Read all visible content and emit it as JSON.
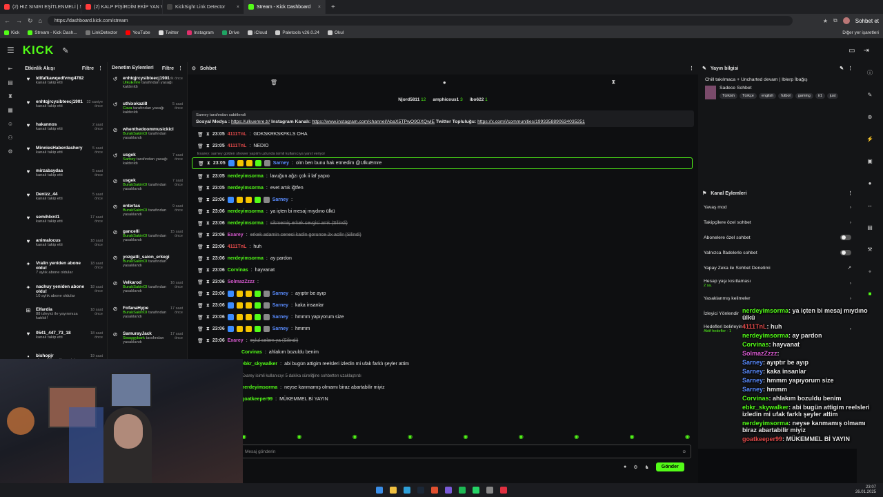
{
  "browser": {
    "tabs": [
      {
        "label": "(2) HIZ SINIRI EŞİTLENMELİ | 5Sni",
        "color": "#ff3b3b"
      },
      {
        "label": "(2) KALP PİŞİRDİM EKİP YAN YATT",
        "color": "#ff3b3b"
      },
      {
        "label": "KickSight Link Detector",
        "color": "#444"
      },
      {
        "label": "Stream - Kick Dashboard",
        "color": "#53fc18"
      }
    ],
    "url": "https://dashboard.kick.com/stream",
    "profile_label": "Sohbet et",
    "bookmarks": [
      {
        "label": "Kick",
        "color": "#53fc18"
      },
      {
        "label": "Stream - Kick Dash...",
        "color": "#53fc18"
      },
      {
        "label": "LinkDetector",
        "color": "#777"
      },
      {
        "label": "YouTube",
        "color": "#ff0000"
      },
      {
        "label": "Twitter",
        "color": "#ddd"
      },
      {
        "label": "Instagram",
        "color": "#e1306c"
      },
      {
        "label": "Drive",
        "color": "#1fa463"
      },
      {
        "label": "iCloud",
        "color": "#ccc"
      },
      {
        "label": "Paletools v26.0.24",
        "color": "#ccc"
      },
      {
        "label": "Okul",
        "color": "#ccc"
      }
    ],
    "other_bookmarks": "Diğer yer işaretleri"
  },
  "kick": {
    "logo": "KICK"
  },
  "activity": {
    "title": "Etkinlik Akışı",
    "filter": "Filtre",
    "items": [
      {
        "name": "ldlfafkawqedfvmg4782",
        "sub": "kanalı takip etti",
        "time": "",
        "icon": "♥"
      },
      {
        "name": "enhtqjrcysibteecj1901",
        "sub": "kanalı takip etti",
        "time": "32 saniye önce",
        "icon": "♥"
      },
      {
        "name": "hakannos",
        "sub": "kanalı takip etti",
        "time": "2 saat önce",
        "icon": "♥"
      },
      {
        "name": "MinniesHaberdashery",
        "sub": "kanalı takip etti",
        "time": "5 saat önce",
        "icon": "♥"
      },
      {
        "name": "mirzabaydas",
        "sub": "kanalı takip etti",
        "time": "5 saat önce",
        "icon": "♥"
      },
      {
        "name": "Denizz_44",
        "sub": "kanalı takip etti",
        "time": "5 saat önce",
        "icon": "♥"
      },
      {
        "name": "semihlxrd1",
        "sub": "kanalı takip etti",
        "time": "17 saat önce",
        "icon": "♥"
      },
      {
        "name": "animalocus",
        "sub": "kanalı takip etti",
        "time": "18 saat önce",
        "icon": "♥"
      },
      {
        "name": "Vralin yeniden abone oldu!",
        "sub": "7 aylık abone oldular",
        "time": "18 saat önce",
        "icon": "✦"
      },
      {
        "name": "nachuy yeniden abone oldu!",
        "sub": "10 aylık abone oldular",
        "time": "18 saat önce",
        "icon": "✦"
      },
      {
        "name": "Elfardia",
        "sub": "88 izleyici ile yayınınıza katıldı!",
        "time": "18 saat önce",
        "icon": "⊞"
      },
      {
        "name": "0541_447_73_18",
        "sub": "kanalı takip etti",
        "time": "18 saat önce",
        "icon": "♥"
      },
      {
        "name": "bishopjr",
        "sub": "aboneliği yenilemesini kutluyor! Toplam abonelik süresi : 17 ay!",
        "time": "19 saat önce",
        "icon": "•"
      }
    ]
  },
  "moderation": {
    "title": "Denetim Eylemleri",
    "filter": "Filtre",
    "items": [
      {
        "name": "enhtqjrcysibteecj1901",
        "mod": "UlkuEmre",
        "action": "tarafından yasağı kaldırıldı",
        "time": "1 dk önce",
        "icon": "↺"
      },
      {
        "name": "uthixokazi8",
        "mod": "Cava",
        "action": "tarafından yasağı kaldırıldı",
        "time": "5 saat önce",
        "icon": "↺"
      },
      {
        "name": "whenthedoommusickicl",
        "mod": "BurakSakinOl",
        "action": "tarafından yasaklandı",
        "time": "",
        "icon": "⊘"
      },
      {
        "name": "usgek",
        "mod": "Sarney",
        "action": "tarafından yasağı kaldırıldı",
        "time": "7 saat önce",
        "icon": "↺"
      },
      {
        "name": "usgek",
        "mod": "BurakSakinOl",
        "action": "tarafından yasaklandı",
        "time": "7 saat önce",
        "icon": "⊘"
      },
      {
        "name": "entertas",
        "mod": "BurakSakinOl",
        "action": "tarafından yasaklandı",
        "time": "9 saat önce",
        "icon": "⊘"
      },
      {
        "name": "gancelli",
        "mod": "BurakSakinOl",
        "action": "tarafından yasaklandı",
        "time": "15 saat önce",
        "icon": "⊘"
      },
      {
        "name": "yozgatli_saion_erkegi",
        "mod": "BurakSakinOl",
        "action": "tarafından yasaklandı",
        "time": "",
        "icon": "⊘"
      },
      {
        "name": "Velkarod",
        "mod": "BurakSakinOl",
        "action": "tarafından yasaklandı",
        "time": "16 saat önce",
        "icon": "⊘"
      },
      {
        "name": "FofanaHype",
        "mod": "BurakSakinOl",
        "action": "tarafından yasaklandı",
        "time": "17 saat önce",
        "icon": "⊘"
      },
      {
        "name": "SamurayJack",
        "mod": "Swaggybark",
        "action": "tarafından yasaklandı",
        "time": "17 saat önce",
        "icon": "⊘"
      }
    ]
  },
  "chat": {
    "title": "Sohbet",
    "top_users": [
      {
        "name": "Njord5811",
        "count": "12"
      },
      {
        "name": "amphioxus1",
        "count": "3"
      },
      {
        "name": "ibo622",
        "count": "1"
      }
    ],
    "pinned": {
      "by": "Sarney tarafından sabitlendi",
      "text_a": "Sosyal Medya : ",
      "link1": "https://ulkuemre.tr/",
      "text_b": " Instagram Kanalı: ",
      "link2": "https://www.instagram.com/channel/AbaX5TPwO9OXQwlE",
      "text_c": " Twitter Topluluğu: ",
      "link3": "https://x.com/i/communities/1993358890634035251"
    },
    "reply_note": "Exarey: sarney golden shower yapılm uzlunda isimli kullanıcıya yanıt veriyor",
    "messages": [
      {
        "time": "23:05",
        "user": "4111TnL",
        "cls": "u-r",
        "text": "GDKSKRKSKFKLS OHA",
        "del": false,
        "badges": []
      },
      {
        "time": "23:05",
        "user": "4111TnL",
        "cls": "u-r",
        "text": "NEDIO",
        "del": false,
        "badges": []
      },
      {
        "time": "23:05",
        "user": "Sarney",
        "cls": "u-b",
        "text": "olm ben bunu hak etmedim @UlkuEmre",
        "del": false,
        "badges": [
          "#3b8cff",
          "#f5c400",
          "#f5c400",
          "#53fc18",
          "#888"
        ]
      },
      {
        "time": "23:05",
        "user": "nerdeyimsorma",
        "cls": "u-g",
        "text": "lavuğun ağzı çok ii laf yapıo",
        "del": false,
        "badges": []
      },
      {
        "time": "23:05",
        "user": "nerdeyimsorma",
        "cls": "u-g",
        "text": "evet artık iğtfen",
        "del": false,
        "badges": []
      },
      {
        "time": "23:06",
        "user": "Sarney",
        "cls": "u-b",
        "text": "",
        "del": false,
        "badges": [
          "#3b8cff",
          "#f5c400",
          "#f5c400",
          "#53fc18",
          "#888"
        ]
      },
      {
        "time": "23:06",
        "user": "nerdeyimsorma",
        "cls": "u-g",
        "text": "ya içten bi mesaj mıydıno ülkü",
        "del": false,
        "badges": []
      },
      {
        "time": "23:06",
        "user": "nerdeyimsorma",
        "cls": "u-g",
        "text": "sikmemiş erkek sevgisi amk (Silindi)",
        "del": true,
        "badges": []
      },
      {
        "time": "23:06",
        "user": "Exarey",
        "cls": "u-p",
        "text": "erkek adamin cenesi kadin gorunce 2x acilir (Silindi)",
        "del": true,
        "badges": []
      },
      {
        "time": "23:06",
        "user": "4111TnL",
        "cls": "u-r",
        "text": "huh",
        "del": false,
        "badges": []
      },
      {
        "time": "23:06",
        "user": "nerdeyimsorma",
        "cls": "u-g",
        "text": "ay pardon",
        "del": false,
        "badges": []
      },
      {
        "time": "23:06",
        "user": "Corvinas",
        "cls": "u-g",
        "text": "hayvanat",
        "del": false,
        "badges": []
      },
      {
        "time": "23:06",
        "user": "SolmazZzzz",
        "cls": "u-p",
        "text": "",
        "del": false,
        "badges": []
      },
      {
        "time": "23:06",
        "user": "Sarney",
        "cls": "u-b",
        "text": "ayıptır be ayıp",
        "del": false,
        "badges": [
          "#3b8cff",
          "#f5c400",
          "#f5c400",
          "#53fc18",
          "#888"
        ]
      },
      {
        "time": "23:06",
        "user": "Sarney",
        "cls": "u-b",
        "text": "kaka insanlar",
        "del": false,
        "badges": [
          "#3b8cff",
          "#f5c400",
          "#f5c400",
          "#53fc18",
          "#888"
        ]
      },
      {
        "time": "23:06",
        "user": "Sarney",
        "cls": "u-b",
        "text": "hmmm yapıyorum size",
        "del": false,
        "badges": [
          "#3b8cff",
          "#f5c400",
          "#f5c400",
          "#53fc18",
          "#888"
        ]
      },
      {
        "time": "23:06",
        "user": "Sarney",
        "cls": "u-b",
        "text": "hmmm",
        "del": false,
        "badges": [
          "#3b8cff",
          "#f5c400",
          "#f5c400",
          "#53fc18",
          "#888"
        ]
      },
      {
        "time": "23:06",
        "user": "Exarey",
        "cls": "u-p",
        "text": "eylul selem ya (Silindi)",
        "del": true,
        "badges": []
      }
    ],
    "partial_lines": [
      {
        "user": "Corvinas",
        "text": "ahlakım bozuldu benim"
      },
      {
        "user": "ebkr_skywalker",
        "text": "abi bugün attigim reelsleri izledin mi ufak farklı şeyler attim"
      },
      {
        "user": "",
        "text": "Exarey isimli kullanıcıyı 5 dakika süreliğine sohbetten uzaklaştırdı"
      },
      {
        "user": "nerdeyimsorma",
        "text": "neyse kanmamış olmamı biraz abartabilir miyiz"
      },
      {
        "user": "goatkeeper99",
        "text": "MÜKEMMEL Bİ YAYIN"
      }
    ],
    "input_placeholder": "Mesaj gönderin",
    "send": "Gönder"
  },
  "stream_info": {
    "title": "Yayın bilgisi",
    "stream_title": "Chill takılmaca + Uncharted devam | Iblerp İbağış",
    "category": "Sadece Sohbet",
    "tags": [
      "Türkish",
      "Türkçe",
      "english",
      "futbol",
      "gaming",
      "ir1",
      "just"
    ]
  },
  "channel_actions": {
    "title": "Kanal Eylemleri",
    "rows": [
      {
        "label": "Yavaş mod",
        "type": "chev"
      },
      {
        "label": "Takipçilere özel sohbet",
        "type": "chev"
      },
      {
        "label": "Abonelere özel sohbet",
        "type": "toggle"
      },
      {
        "label": "Yalnızca İfadelerle sohbet",
        "type": "toggle"
      },
      {
        "label": "Yapay Zeka ile Sohbet Denetimi",
        "type": "ext"
      },
      {
        "label": "Hesap yaşı kısıtlaması",
        "type": "chev",
        "sub": "2 sa."
      },
      {
        "label": "Yasaklanmış kelimeler",
        "type": "chev"
      },
      {
        "label": "İzleyici Yönlendir",
        "type": "none"
      },
      {
        "label": "Hedefleri belirleyin",
        "type": "chev",
        "sub": "Aktif hedefler · 1"
      }
    ]
  },
  "overlay_chat": [
    {
      "user": "nerdeyimsorma",
      "color": "#53fc18",
      "text": ": ya içten bi mesaj mıydıno ülkü"
    },
    {
      "user": "4111TnL",
      "color": "#e24a4a",
      "text": ": huh"
    },
    {
      "user": "nerdeyimsorma",
      "color": "#53fc18",
      "text": ": ay pardon"
    },
    {
      "user": "Corvinas",
      "color": "#53fc18",
      "text": ": hayvanat"
    },
    {
      "user": "SolmazZzzz",
      "color": "#d85ad0",
      "text": ":"
    },
    {
      "user": "Sarney",
      "color": "#5a8cff",
      "text": ": ayıptır be ayıp"
    },
    {
      "user": "Sarney",
      "color": "#5a8cff",
      "text": ": kaka insanlar"
    },
    {
      "user": "Sarney",
      "color": "#5a8cff",
      "text": ": hmmm yapıyorum size"
    },
    {
      "user": "Sarney",
      "color": "#5a8cff",
      "text": ": hmmm"
    },
    {
      "user": "Corvinas",
      "color": "#53fc18",
      "text": ": ahlakım bozuldu benim"
    },
    {
      "user": "ebkr_skywalker",
      "color": "#53fc18",
      "text": ": abi bugün attigim reelsleri izledin mi ufak farklı şeyler attim"
    },
    {
      "user": "nerdeyimsorma",
      "color": "#53fc18",
      "text": ": neyse kanmamış olmamı biraz abartabilir miyiz"
    },
    {
      "user": "goatkeeper99",
      "color": "#e24a4a",
      "text": ": MÜKEMMEL Bİ YAYIN"
    }
  ],
  "taskbar": {
    "time": "23:07",
    "date": "26.01.2025"
  }
}
